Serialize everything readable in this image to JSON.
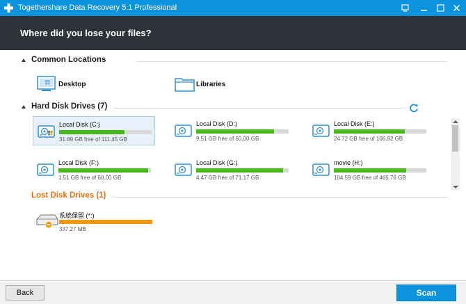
{
  "window": {
    "title": "Togethershare Data Recovery 5.1 Professional",
    "icons": [
      "app-plus-icon",
      "restore-icon",
      "minimize-icon",
      "maximize-icon",
      "close-icon"
    ]
  },
  "header": {
    "heading": "Where did you lose your files?"
  },
  "sections": {
    "common": {
      "label": "Common Locations",
      "items": [
        {
          "label": "Desktop",
          "icon": "desktop-icon"
        },
        {
          "label": "Libraries",
          "icon": "folder-icon"
        }
      ]
    },
    "hard": {
      "label": "Hard Disk Drives (7)",
      "drives": [
        {
          "name": "Local Disk (C:)",
          "info": "31.89 GB free of 111.45 GB",
          "used_fraction": 0.71,
          "selected": true,
          "icon": "windows-disk-icon"
        },
        {
          "name": "Local Disk (D:)",
          "info": "9.51 GB free of 60.00 GB",
          "used_fraction": 0.84,
          "icon": "disk-icon"
        },
        {
          "name": "Local Disk (E:)",
          "info": "24.72 GB free of 106.92 GB",
          "used_fraction": 0.77,
          "icon": "disk-icon"
        },
        {
          "name": "Local Disk (F:)",
          "info": "1.51 GB free of 60.00 GB",
          "used_fraction": 0.97,
          "icon": "disk-icon"
        },
        {
          "name": "Local Disk (G:)",
          "info": "4.47 GB free of 71.17 GB",
          "used_fraction": 0.94,
          "icon": "disk-icon"
        },
        {
          "name": "movie (H:)",
          "info": "104.59 GB free of 465.76 GB",
          "used_fraction": 0.78,
          "icon": "disk-icon"
        }
      ]
    },
    "lost": {
      "label": "Lost Disk Drives (1)",
      "drives": [
        {
          "name": "系統保留 (*:)",
          "info": "337.27 MB",
          "used_fraction": 1.0,
          "icon": "lost-disk-icon"
        }
      ]
    }
  },
  "footer": {
    "back_label": "Back",
    "scan_label": "Scan"
  },
  "colors": {
    "titlebar": "#0c93dd",
    "header": "#2f3238",
    "accent": "#0c93dd",
    "bar_fill": "#48b81a",
    "lost_bar_fill": "#f39811",
    "lost_label": "#e9710f"
  }
}
